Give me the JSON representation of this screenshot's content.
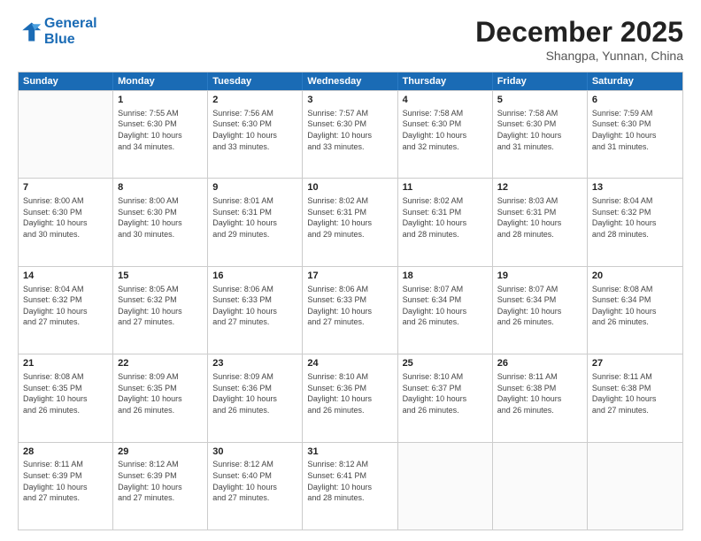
{
  "header": {
    "logo_line1": "General",
    "logo_line2": "Blue",
    "month": "December 2025",
    "location": "Shangpa, Yunnan, China"
  },
  "weekdays": [
    "Sunday",
    "Monday",
    "Tuesday",
    "Wednesday",
    "Thursday",
    "Friday",
    "Saturday"
  ],
  "rows": [
    [
      {
        "day": "",
        "info": ""
      },
      {
        "day": "1",
        "info": "Sunrise: 7:55 AM\nSunset: 6:30 PM\nDaylight: 10 hours\nand 34 minutes."
      },
      {
        "day": "2",
        "info": "Sunrise: 7:56 AM\nSunset: 6:30 PM\nDaylight: 10 hours\nand 33 minutes."
      },
      {
        "day": "3",
        "info": "Sunrise: 7:57 AM\nSunset: 6:30 PM\nDaylight: 10 hours\nand 33 minutes."
      },
      {
        "day": "4",
        "info": "Sunrise: 7:58 AM\nSunset: 6:30 PM\nDaylight: 10 hours\nand 32 minutes."
      },
      {
        "day": "5",
        "info": "Sunrise: 7:58 AM\nSunset: 6:30 PM\nDaylight: 10 hours\nand 31 minutes."
      },
      {
        "day": "6",
        "info": "Sunrise: 7:59 AM\nSunset: 6:30 PM\nDaylight: 10 hours\nand 31 minutes."
      }
    ],
    [
      {
        "day": "7",
        "info": "Sunrise: 8:00 AM\nSunset: 6:30 PM\nDaylight: 10 hours\nand 30 minutes."
      },
      {
        "day": "8",
        "info": "Sunrise: 8:00 AM\nSunset: 6:30 PM\nDaylight: 10 hours\nand 30 minutes."
      },
      {
        "day": "9",
        "info": "Sunrise: 8:01 AM\nSunset: 6:31 PM\nDaylight: 10 hours\nand 29 minutes."
      },
      {
        "day": "10",
        "info": "Sunrise: 8:02 AM\nSunset: 6:31 PM\nDaylight: 10 hours\nand 29 minutes."
      },
      {
        "day": "11",
        "info": "Sunrise: 8:02 AM\nSunset: 6:31 PM\nDaylight: 10 hours\nand 28 minutes."
      },
      {
        "day": "12",
        "info": "Sunrise: 8:03 AM\nSunset: 6:31 PM\nDaylight: 10 hours\nand 28 minutes."
      },
      {
        "day": "13",
        "info": "Sunrise: 8:04 AM\nSunset: 6:32 PM\nDaylight: 10 hours\nand 28 minutes."
      }
    ],
    [
      {
        "day": "14",
        "info": "Sunrise: 8:04 AM\nSunset: 6:32 PM\nDaylight: 10 hours\nand 27 minutes."
      },
      {
        "day": "15",
        "info": "Sunrise: 8:05 AM\nSunset: 6:32 PM\nDaylight: 10 hours\nand 27 minutes."
      },
      {
        "day": "16",
        "info": "Sunrise: 8:06 AM\nSunset: 6:33 PM\nDaylight: 10 hours\nand 27 minutes."
      },
      {
        "day": "17",
        "info": "Sunrise: 8:06 AM\nSunset: 6:33 PM\nDaylight: 10 hours\nand 27 minutes."
      },
      {
        "day": "18",
        "info": "Sunrise: 8:07 AM\nSunset: 6:34 PM\nDaylight: 10 hours\nand 26 minutes."
      },
      {
        "day": "19",
        "info": "Sunrise: 8:07 AM\nSunset: 6:34 PM\nDaylight: 10 hours\nand 26 minutes."
      },
      {
        "day": "20",
        "info": "Sunrise: 8:08 AM\nSunset: 6:34 PM\nDaylight: 10 hours\nand 26 minutes."
      }
    ],
    [
      {
        "day": "21",
        "info": "Sunrise: 8:08 AM\nSunset: 6:35 PM\nDaylight: 10 hours\nand 26 minutes."
      },
      {
        "day": "22",
        "info": "Sunrise: 8:09 AM\nSunset: 6:35 PM\nDaylight: 10 hours\nand 26 minutes."
      },
      {
        "day": "23",
        "info": "Sunrise: 8:09 AM\nSunset: 6:36 PM\nDaylight: 10 hours\nand 26 minutes."
      },
      {
        "day": "24",
        "info": "Sunrise: 8:10 AM\nSunset: 6:36 PM\nDaylight: 10 hours\nand 26 minutes."
      },
      {
        "day": "25",
        "info": "Sunrise: 8:10 AM\nSunset: 6:37 PM\nDaylight: 10 hours\nand 26 minutes."
      },
      {
        "day": "26",
        "info": "Sunrise: 8:11 AM\nSunset: 6:38 PM\nDaylight: 10 hours\nand 26 minutes."
      },
      {
        "day": "27",
        "info": "Sunrise: 8:11 AM\nSunset: 6:38 PM\nDaylight: 10 hours\nand 27 minutes."
      }
    ],
    [
      {
        "day": "28",
        "info": "Sunrise: 8:11 AM\nSunset: 6:39 PM\nDaylight: 10 hours\nand 27 minutes."
      },
      {
        "day": "29",
        "info": "Sunrise: 8:12 AM\nSunset: 6:39 PM\nDaylight: 10 hours\nand 27 minutes."
      },
      {
        "day": "30",
        "info": "Sunrise: 8:12 AM\nSunset: 6:40 PM\nDaylight: 10 hours\nand 27 minutes."
      },
      {
        "day": "31",
        "info": "Sunrise: 8:12 AM\nSunset: 6:41 PM\nDaylight: 10 hours\nand 28 minutes."
      },
      {
        "day": "",
        "info": ""
      },
      {
        "day": "",
        "info": ""
      },
      {
        "day": "",
        "info": ""
      }
    ]
  ]
}
